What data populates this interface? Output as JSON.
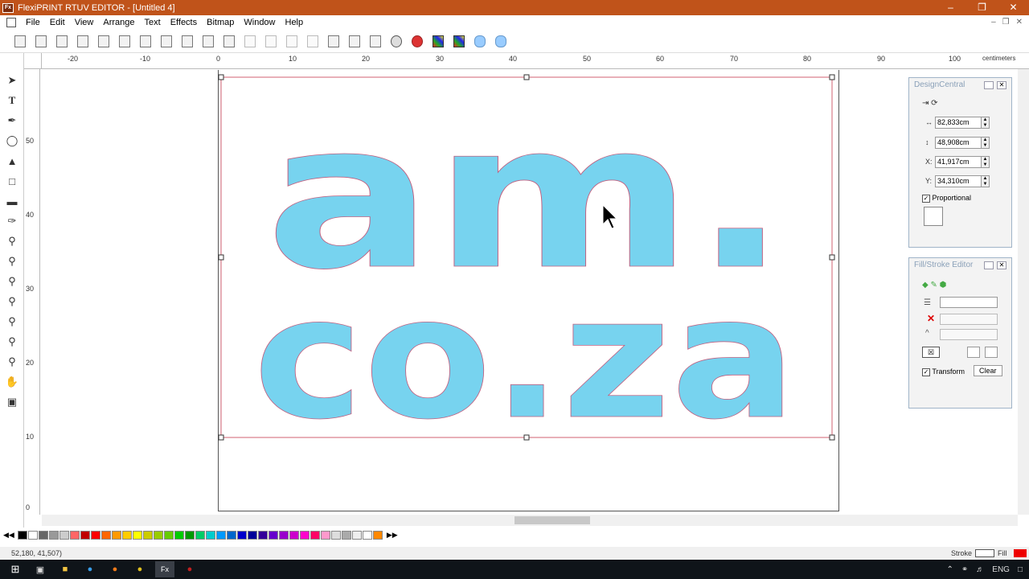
{
  "window": {
    "title": "FlexiPRINT RTUV EDITOR - [Untitled 4]",
    "app_icon": "Fx"
  },
  "menu": [
    "File",
    "Edit",
    "View",
    "Arrange",
    "Text",
    "Effects",
    "Bitmap",
    "Window",
    "Help"
  ],
  "toolbar": {
    "icons": [
      "new-document-icon",
      "open-icon",
      "save-icon",
      "save-as-icon",
      "import-icon",
      "export-icon",
      "print-icon",
      "rip-print-icon",
      "cut-icon",
      "copy-icon",
      "paste-icon",
      "undo-icon",
      "undo-all-icon",
      "redo-icon",
      "redo-all-icon",
      "align-icon",
      "distribute-icon",
      "arrange-icon",
      "color-wheel-icon",
      "ink-icon",
      "color-picker-icon",
      "spectrum-icon",
      "cloud-icon",
      "cloud-upload-icon"
    ]
  },
  "ruler": {
    "unit": "centimeters",
    "h_ticks": [
      "-20",
      "-10",
      "0",
      "10",
      "20",
      "30",
      "40",
      "50",
      "60",
      "70",
      "80",
      "90",
      "100"
    ],
    "v_ticks": [
      "50",
      "40",
      "30",
      "20",
      "10",
      "0"
    ]
  },
  "tools": [
    "select-arrow-icon",
    "text-tool-icon",
    "pen-tool-icon",
    "ellipse-tool-icon",
    "node-edit-icon",
    "crop-tool-icon",
    "measure-tool-icon",
    "eyedropper-icon",
    "zoom-icon",
    "zoom-in-icon",
    "zoom-out-icon",
    "zoom-fit-icon",
    "zoom-page-icon",
    "zoom-all-icon",
    "zoom-selected-icon",
    "pan-hand-icon",
    "fill-tool-icon"
  ],
  "design_text": {
    "line1": "am.",
    "line2": "co.za"
  },
  "design_central": {
    "title": "DesignCentral",
    "width": "82,833cm",
    "height": "48,908cm",
    "x_label": "X:",
    "x": "41,917cm",
    "y_label": "Y:",
    "y": "34,310cm",
    "proportional": "Proportional"
  },
  "fill_stroke": {
    "title": "Fill/Stroke Editor",
    "transform": "Transform",
    "clear": "Clear"
  },
  "palette": {
    "colors": [
      "#000000",
      "#ffffff",
      "#666666",
      "#999999",
      "#cccccc",
      "#ff6666",
      "#c00000",
      "#ff0000",
      "#ff6600",
      "#ff9900",
      "#ffcc00",
      "#ffff00",
      "#cccc00",
      "#99cc00",
      "#66cc00",
      "#00cc00",
      "#009900",
      "#00cc66",
      "#00cccc",
      "#0099ff",
      "#0066cc",
      "#0000cc",
      "#000099",
      "#330099",
      "#6600cc",
      "#9900cc",
      "#cc00cc",
      "#ff00cc",
      "#ff0066",
      "#ff99cc",
      "#dddddd",
      "#aaaaaa",
      "#eeeeee",
      "#ffffff",
      "#ff8800"
    ]
  },
  "status": {
    "coords": "52,180,     41,507)",
    "stroke": "Stroke",
    "fill": "Fill"
  },
  "taskbar": {
    "lang": "ENG"
  }
}
